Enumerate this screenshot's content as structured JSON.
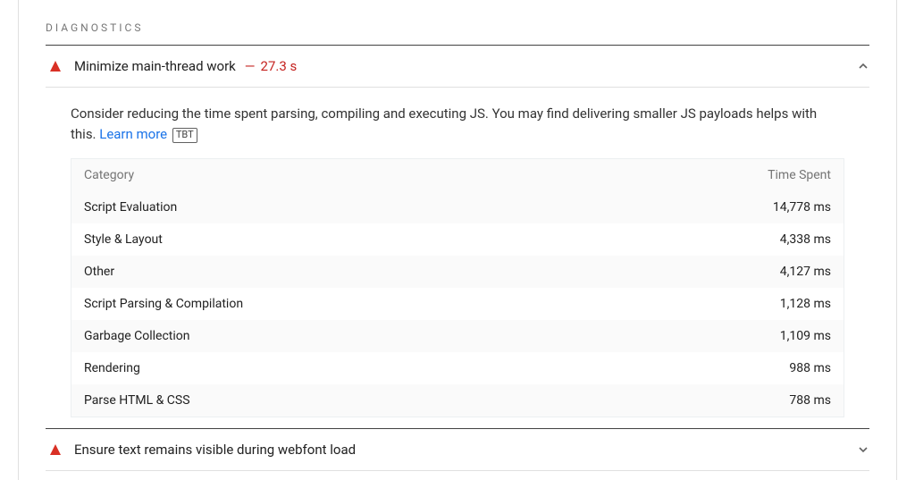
{
  "section_label": "DIAGNOSTICS",
  "audits": [
    {
      "title": "Minimize main-thread work",
      "value": "27.3 s",
      "expanded": true,
      "description_pre": "Consider reducing the time spent parsing, compiling and executing JS. You may find delivering smaller JS payloads helps with this. ",
      "learn_more": "Learn more",
      "tag": "TBT",
      "table": {
        "col_category": "Category",
        "col_time": "Time Spent",
        "rows": [
          {
            "category": "Script Evaluation",
            "time": "14,778 ms"
          },
          {
            "category": "Style & Layout",
            "time": "4,338 ms"
          },
          {
            "category": "Other",
            "time": "4,127 ms"
          },
          {
            "category": "Script Parsing & Compilation",
            "time": "1,128 ms"
          },
          {
            "category": "Garbage Collection",
            "time": "1,109 ms"
          },
          {
            "category": "Rendering",
            "time": "988 ms"
          },
          {
            "category": "Parse HTML & CSS",
            "time": "788 ms"
          }
        ]
      }
    },
    {
      "title": "Ensure text remains visible during webfont load",
      "value": "",
      "expanded": false
    }
  ]
}
